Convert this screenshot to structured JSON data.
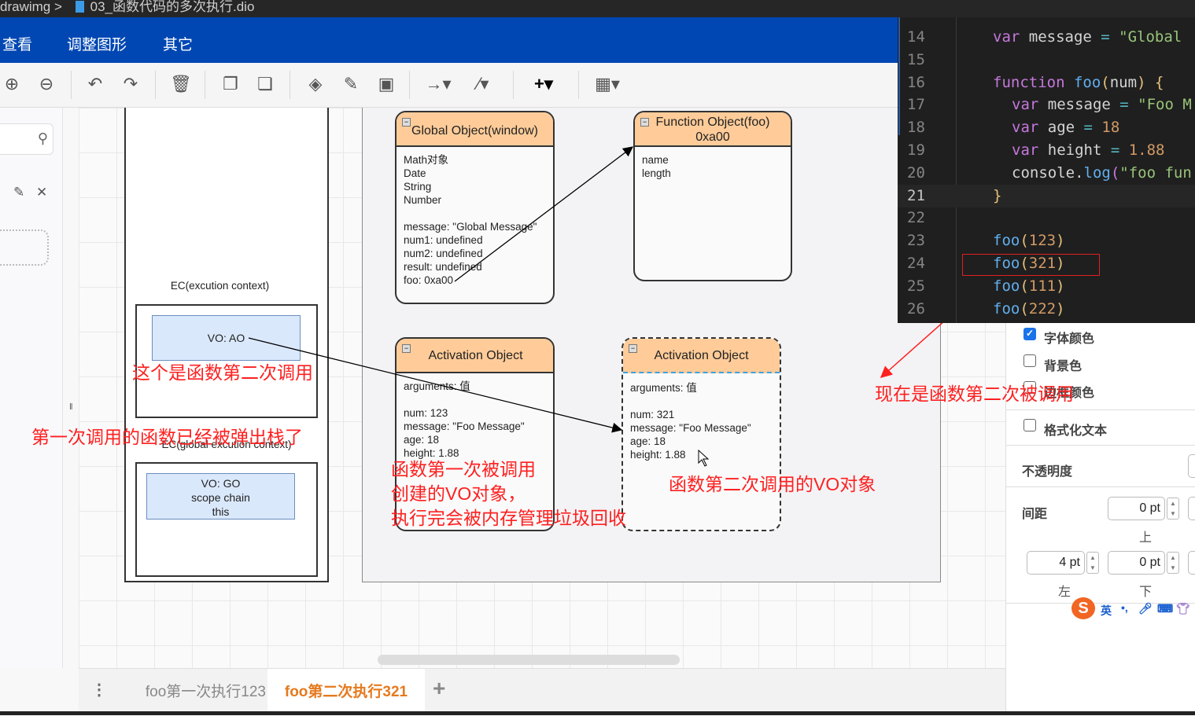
{
  "titlebar": {
    "breadcrumb": "drawimg > ",
    "filename": "03_函数代码的多次执行.dio"
  },
  "menu": {
    "items": [
      "查看",
      "调整图形",
      "其它"
    ]
  },
  "toolbar": {
    "icons": [
      "zoom-in",
      "zoom-out",
      "undo",
      "redo",
      "delete",
      "to-front",
      "to-back",
      "fill-color",
      "line-color",
      "shadow",
      "connection",
      "waypoints",
      "insert",
      "table"
    ]
  },
  "diagram": {
    "ec_label": "EC(excution context)",
    "vo_ao": "VO: AO",
    "gec_label": "EC(global excution context)",
    "vo_go": [
      "VO: GO",
      "scope chain",
      "this"
    ],
    "global_object": {
      "title": "Global Object(window)",
      "body": "Math对象\nDate\nString\nNumber\n\nmessage: \"Global Message\"\nnum1: undefined\nnum2: undefined\nresult: undefined\nfoo: 0xa00"
    },
    "function_object": {
      "title_line1": "Function Object(foo)",
      "title_line2": "0xa00",
      "body": "name\nlength"
    },
    "ao1": {
      "title": "Activation Object",
      "body": "arguments: 值\n\nnum: 123\nmessage: \"Foo Message\"\nage: 18\nheight: 1.88"
    },
    "ao2": {
      "title": "Activation Object",
      "body": "arguments: 值\n\nnum: 321\nmessage: \"Foo Message\"\nage: 18\nheight: 1.88"
    }
  },
  "annotations": {
    "second_call": "这个是函数第二次调用",
    "popped": "第一次调用的函数已经被弹出栈了",
    "first_call": "函数第一次被调用\n创建的VO对象，\n执行完会被内存管理垃圾回收",
    "second_vo": "函数第二次调用的VO对象",
    "now_second": "现在是函数第二次被调用",
    "color": "#ff2020"
  },
  "code": {
    "lines": [
      {
        "num": "14",
        "tokens": [
          [
            "k",
            "var "
          ],
          [
            "v",
            "message "
          ],
          [
            "o",
            "= "
          ],
          [
            "s",
            "\"Global"
          ]
        ],
        "indent": 0
      },
      {
        "num": "15",
        "tokens": [],
        "indent": 0
      },
      {
        "num": "16",
        "tokens": [
          [
            "k",
            "function "
          ],
          [
            "f",
            "foo"
          ],
          [
            "p",
            "("
          ],
          [
            "v",
            "num"
          ],
          [
            "p",
            ") {"
          ]
        ],
        "indent": 0
      },
      {
        "num": "17",
        "tokens": [
          [
            "k",
            "var "
          ],
          [
            "v",
            "message "
          ],
          [
            "o",
            "= "
          ],
          [
            "s",
            "\"Foo M"
          ]
        ],
        "indent": 1
      },
      {
        "num": "18",
        "tokens": [
          [
            "k",
            "var "
          ],
          [
            "v",
            "age "
          ],
          [
            "o",
            "= "
          ],
          [
            "n",
            "18"
          ]
        ],
        "indent": 1
      },
      {
        "num": "19",
        "tokens": [
          [
            "k",
            "var "
          ],
          [
            "v",
            "height "
          ],
          [
            "o",
            "= "
          ],
          [
            "n",
            "1.88"
          ]
        ],
        "indent": 1
      },
      {
        "num": "20",
        "tokens": [
          [
            "v",
            "console."
          ],
          [
            "f",
            "log"
          ],
          [
            "k",
            "("
          ],
          [
            "s",
            "\"foo fun"
          ]
        ],
        "indent": 1
      },
      {
        "num": "21",
        "tokens": [
          [
            "p",
            "}"
          ]
        ],
        "indent": 0,
        "current": true
      },
      {
        "num": "22",
        "tokens": [],
        "indent": 0
      },
      {
        "num": "23",
        "tokens": [
          [
            "f",
            "foo"
          ],
          [
            "p",
            "("
          ],
          [
            "n",
            "123"
          ],
          [
            "p",
            ")"
          ]
        ],
        "indent": 0
      },
      {
        "num": "24",
        "tokens": [
          [
            "f",
            "foo"
          ],
          [
            "p",
            "("
          ],
          [
            "n",
            "321"
          ],
          [
            "p",
            ")"
          ]
        ],
        "indent": 0
      },
      {
        "num": "25",
        "tokens": [
          [
            "f",
            "foo"
          ],
          [
            "p",
            "("
          ],
          [
            "n",
            "111"
          ],
          [
            "p",
            ")"
          ]
        ],
        "indent": 0
      },
      {
        "num": "26",
        "tokens": [
          [
            "f",
            "foo"
          ],
          [
            "p",
            "("
          ],
          [
            "n",
            "222"
          ],
          [
            "p",
            ")"
          ]
        ],
        "indent": 0
      }
    ],
    "highlighted_line": "24"
  },
  "panel": {
    "font_color": "字体颜色",
    "font_color_checked": true,
    "background": "背景色",
    "background_checked": false,
    "border_color": "边框颜色",
    "border_color_checked": false,
    "formatted_text": "格式化文本",
    "formatted_text_checked": false,
    "opacity": "不透明度",
    "spacing": "间距",
    "top_value": "0 pt",
    "top_label": "上",
    "left_value": "4 pt",
    "left_label": "左",
    "bottom_value": "0 pt",
    "bottom_label": "下"
  },
  "ime": {
    "lang": "英"
  },
  "tabs": {
    "items": [
      "foo第一次执行123",
      "foo第二次执行321"
    ],
    "active": 1,
    "add": "+"
  }
}
